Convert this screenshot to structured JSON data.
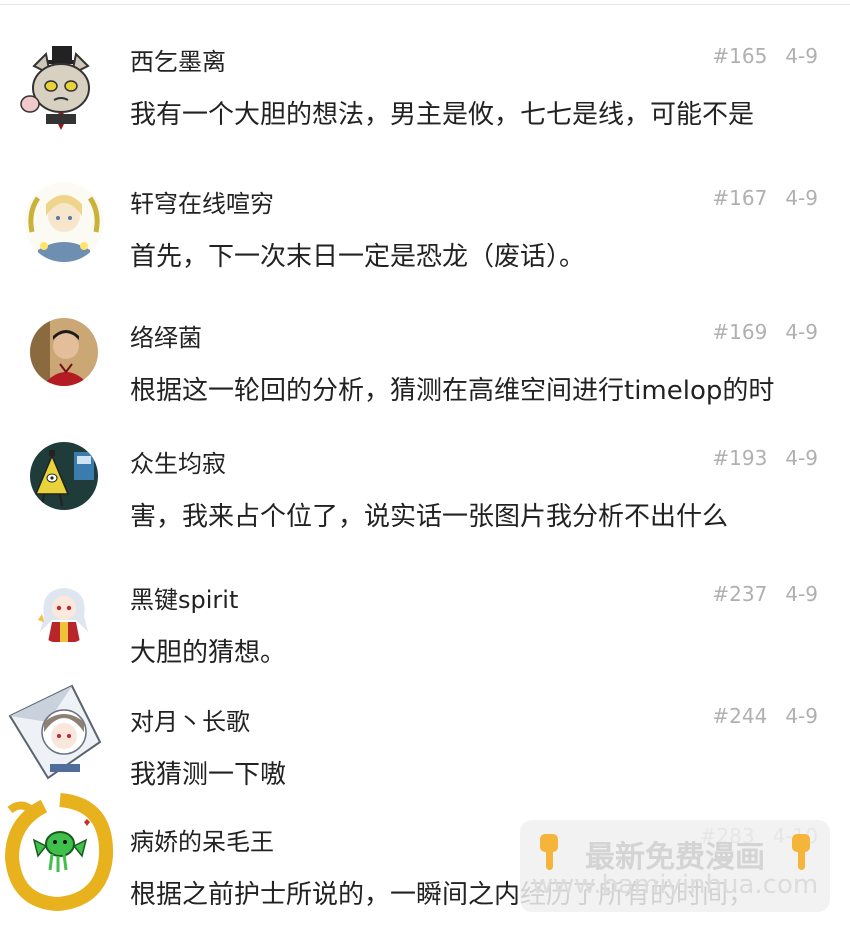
{
  "comments": [
    {
      "username": "西乞墨离",
      "floor": "#165",
      "date": "4-9",
      "content": "我有一个大胆的想法，男主是攸，七七是线，可能不是"
    },
    {
      "username": "轩穹在线喧穷",
      "floor": "#167",
      "date": "4-9",
      "content": "首先，下一次末日一定是恐龙（废话）。"
    },
    {
      "username": "络绎菌",
      "floor": "#169",
      "date": "4-9",
      "content": "根据这一轮回的分析，猜测在高维空间进行timelop的时"
    },
    {
      "username": "众生均寂",
      "floor": "#193",
      "date": "4-9",
      "content": "害，我来占个位了，说实话一张图片我分析不出什么"
    },
    {
      "username": "黑键spirit",
      "floor": "#237",
      "date": "4-9",
      "content": "大胆的猜想。"
    },
    {
      "username": "对月丶长歌",
      "floor": "#244",
      "date": "4-9",
      "content": "我猜测一下嗷"
    },
    {
      "username": "病娇的呆毛王",
      "floor": "#283",
      "date": "4-10",
      "content": "根据之前护士所说的，一瞬间之内经历了所有的时间，"
    }
  ],
  "watermark": {
    "text": "最新免费漫画",
    "url": "www.bamiyinhua.com",
    "icon": "pointing-down-hand-icon"
  },
  "colors": {
    "text": "#222222",
    "meta": "#b0b0b0",
    "divider": "#e6e6e6"
  }
}
